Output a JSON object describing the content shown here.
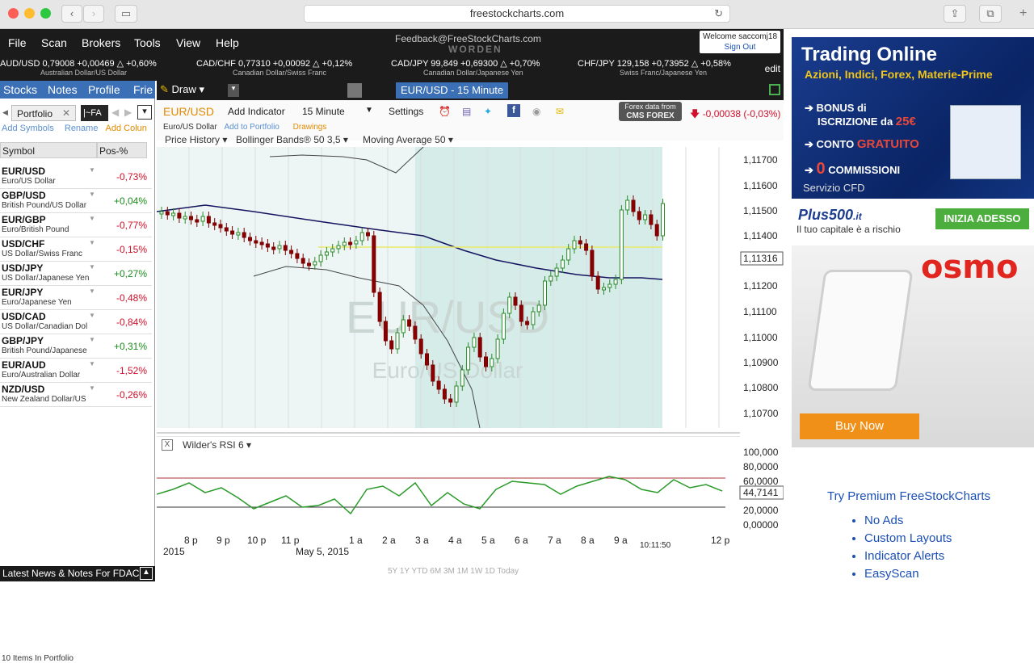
{
  "browser": {
    "url": "freestockcharts.com"
  },
  "menu": [
    "File",
    "Scan",
    "Brokers",
    "Tools",
    "View",
    "Help"
  ],
  "header": {
    "feedback": "Feedback@FreeStockCharts.com",
    "brand": "WORDEN",
    "welcome": "Welcome saccomj18",
    "sign_out": "Sign Out"
  },
  "ticker": [
    {
      "text": "AUD/USD 0,79008 +0,00469 △ +0,60%",
      "sub": "Australian Dollar/US Dollar"
    },
    {
      "text": "CAD/CHF 0,77310 +0,00092 △ +0,12%",
      "sub": "Canadian Dollar/Swiss Franc"
    },
    {
      "text": "CAD/JPY 99,849 +0,69300 △ +0,70%",
      "sub": "Canadian Dollar/Japanese Yen"
    },
    {
      "text": "CHF/JPY 129,158 +0,73952 △ +0,58%",
      "sub": "Swiss Franc/Japanese Yen"
    }
  ],
  "ticker_edit": "edit",
  "nav_tabs": [
    "Stocks",
    "Notes",
    "Profile",
    "Frie"
  ],
  "portfolio": {
    "tab": "Portfolio",
    "tab2": "|~FA",
    "links": {
      "add_symbols": "Add Symbols",
      "rename": "Rename",
      "add_column": "Add Colun"
    },
    "columns": [
      "Symbol",
      "Pos-%"
    ],
    "rows": [
      {
        "sym": "EUR/USD",
        "desc": "Euro/US Dollar",
        "pct": "-0,73%",
        "dir": "neg"
      },
      {
        "sym": "GBP/USD",
        "desc": "British Pound/US Dollar",
        "pct": "+0,04%",
        "dir": "pos"
      },
      {
        "sym": "EUR/GBP",
        "desc": "Euro/British Pound",
        "pct": "-0,77%",
        "dir": "neg"
      },
      {
        "sym": "USD/CHF",
        "desc": "US Dollar/Swiss Franc",
        "pct": "-0,15%",
        "dir": "neg"
      },
      {
        "sym": "USD/JPY",
        "desc": "US Dollar/Japanese Yen",
        "pct": "+0,27%",
        "dir": "pos"
      },
      {
        "sym": "EUR/JPY",
        "desc": "Euro/Japanese Yen",
        "pct": "-0,48%",
        "dir": "neg"
      },
      {
        "sym": "USD/CAD",
        "desc": "US Dollar/Canadian Dol",
        "pct": "-0,84%",
        "dir": "neg"
      },
      {
        "sym": "GBP/JPY",
        "desc": "British Pound/Japanese",
        "pct": "+0,31%",
        "dir": "pos"
      },
      {
        "sym": "EUR/AUD",
        "desc": "Euro/Australian Dollar",
        "pct": "-1,52%",
        "dir": "neg"
      },
      {
        "sym": "NZD/USD",
        "desc": "New Zealand Dollar/US",
        "pct": "-0,26%",
        "dir": "neg"
      }
    ],
    "count": "10 Items In Portfolio",
    "news": "Latest News & Notes For FDAC"
  },
  "chart": {
    "draw": "Draw",
    "tab_title": "EUR/USD - 15 Minute",
    "symbol": "EUR/USD",
    "symbol_desc": "Euro/US Dollar",
    "add_to_portfolio": "Add to Portfolio",
    "drawings": "Drawings",
    "add_indicator": "Add Indicator",
    "interval": "15 Minute",
    "settings": "Settings",
    "data_from": "Forex data from",
    "data_provider": "CMS FOREX",
    "change": "-0,00038 (-0,03%)",
    "indicators": [
      "Price History",
      "Bollinger Bands® 50 3,5",
      "Moving Average 50"
    ],
    "watermark": "EUR/USD",
    "watermark_sub": "Euro/US Dollar",
    "price_ticks": [
      "1,11700",
      "1,11600",
      "1,11500",
      "1,11400",
      "1,11316",
      "1,11200",
      "1,11100",
      "1,11000",
      "1,10900",
      "1,10800",
      "1,10700"
    ],
    "rsi_label": "Wilder's RSI 6",
    "rsi_ticks": [
      "100,000",
      "80,0000",
      "60,0000",
      "44,7141",
      "20,0000",
      "0,00000"
    ],
    "time_labels": [
      "8 p",
      "9 p",
      "10 p",
      "11 p",
      "1 a",
      "2 a",
      "3 a",
      "4 a",
      "5 a",
      "6 a",
      "7 a",
      "8 a",
      "9 a",
      "12 p"
    ],
    "date_labels": [
      "2015",
      "May 5, 2015"
    ],
    "clock": "10:11:50",
    "zoom": "5Y 1Y YTD 6M 3M 1M 1W 1D Today"
  },
  "chart_data": {
    "type": "line",
    "title": "EUR/USD - 15 Minute",
    "ylim": [
      1.107,
      1.1175
    ],
    "close_value": 1.11316,
    "rsi_value": 44.7141
  },
  "ad1": {
    "title": "Trading Online",
    "subtitle": "Azioni, Indici, Forex, Materie-Prime",
    "b1a": "BONUS di",
    "b1b": "ISCRIZIONE da ",
    "b1c": "25€",
    "b2a": "CONTO ",
    "b2b": "GRATUITO",
    "b3a": "0",
    "b3b": " COMMISSIONI",
    "servizio": "Servizio CFD",
    "brand": "Plus500",
    "brand_suffix": ".it",
    "risk": "Il tuo capitale è a rischio",
    "cta": "INIZIA ADESSO"
  },
  "ad2": {
    "brand": "osmo",
    "cta": "Buy Now"
  },
  "premium": {
    "title": "Try Premium FreeStockCharts",
    "items": [
      "No Ads",
      "Custom Layouts",
      "Indicator Alerts",
      "EasyScan"
    ]
  }
}
